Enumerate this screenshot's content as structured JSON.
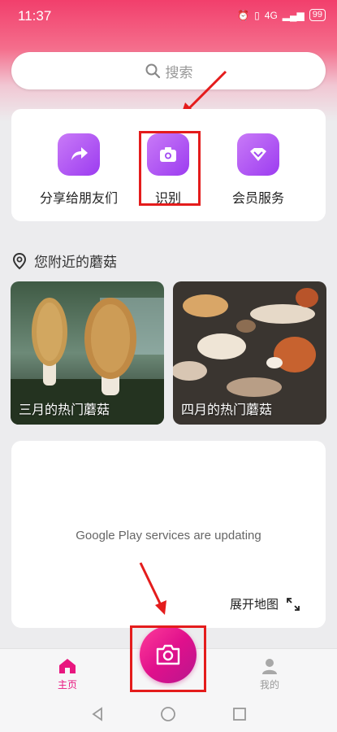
{
  "status": {
    "time": "11:37",
    "signal": "4G",
    "battery": "99"
  },
  "search": {
    "label": "搜索"
  },
  "quick": {
    "items": [
      {
        "label": "分享给朋友们",
        "icon": "share-arrow-icon"
      },
      {
        "label": "识别",
        "icon": "camera-icon"
      },
      {
        "label": "会员服务",
        "icon": "heart-diamond-icon"
      }
    ]
  },
  "nearby": {
    "title": "您附近的蘑菇",
    "tiles": [
      {
        "caption": "三月的热门蘑菇"
      },
      {
        "caption": "四月的热门蘑菇"
      }
    ]
  },
  "map": {
    "message": "Google Play services are updating",
    "expand_label": "展开地图"
  },
  "nav": {
    "home_label": "主页",
    "me_label": "我的"
  },
  "colors": {
    "accent": "#e8167f",
    "highlight": "#e41c1c",
    "purple": "#a24cf2"
  }
}
